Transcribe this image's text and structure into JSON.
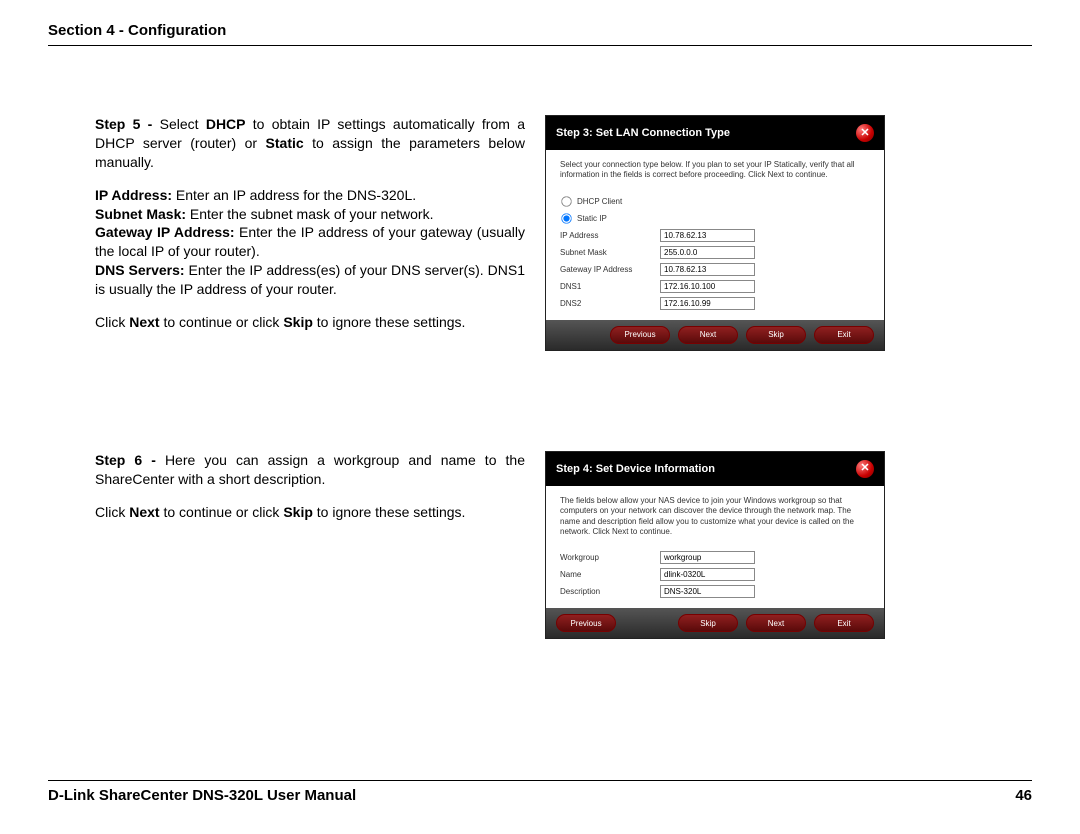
{
  "header": {
    "section": "Section 4 - Configuration"
  },
  "footer": {
    "manual": "D-Link ShareCenter DNS-320L User Manual",
    "page": "46"
  },
  "step5": {
    "para1_pre": "Step 5 - ",
    "para1_a": "Select ",
    "para1_dhcp": "DHCP",
    "para1_b": " to obtain IP settings automatically from a DHCP server (router) or ",
    "para1_static": "Static",
    "para1_c": " to assign the parameters below manually.",
    "ip_b": "IP Address:",
    "ip_t": " Enter an IP address for the DNS-320L.",
    "sm_b": "Subnet Mask:",
    "sm_t": " Enter the subnet mask of your network.",
    "gw_b": "Gateway IP Address:",
    "gw_t": " Enter the IP address of your gateway (usually the local IP of your router).",
    "dns_b": "DNS Servers:",
    "dns_t": " Enter the IP address(es) of your DNS server(s). DNS1 is usually the IP address of your router.",
    "click_a": "Click ",
    "click_next": "Next",
    "click_b": " to continue or click ",
    "click_skip": "Skip",
    "click_c": " to ignore these settings."
  },
  "step6": {
    "para1_pre": "Step 6 - ",
    "para1_t": "Here you can assign a workgroup and name to the ShareCenter with a short description.",
    "click_a": "Click ",
    "click_next": "Next",
    "click_b": " to continue or click ",
    "click_skip": "Skip",
    "click_c": " to ignore these settings."
  },
  "dialog1": {
    "title": "Step 3: Set LAN Connection Type",
    "help": "Select your connection type below. If you plan to set your IP Statically, verify that all information in the fields is correct before proceeding. Click Next to continue.",
    "radio_dhcp": "DHCP Client",
    "radio_static": "Static IP",
    "f_ip": "IP Address",
    "v_ip": "10.78.62.13",
    "f_sm": "Subnet Mask",
    "v_sm": "255.0.0.0",
    "f_gw": "Gateway IP Address",
    "v_gw": "10.78.62.13",
    "f_d1": "DNS1",
    "v_d1": "172.16.10.100",
    "f_d2": "DNS2",
    "v_d2": "172.16.10.99",
    "btn_prev": "Previous",
    "btn_next": "Next",
    "btn_skip": "Skip",
    "btn_exit": "Exit"
  },
  "dialog2": {
    "title": "Step 4: Set Device Information",
    "help": "The fields below allow your NAS device to join your Windows workgroup so that computers on your network can discover the device through the network map. The name and description field allow you to customize what your device is called on the network. Click Next to continue.",
    "f_wg": "Workgroup",
    "v_wg": "workgroup",
    "f_nm": "Name",
    "v_nm": "dlink-0320L",
    "f_ds": "Description",
    "v_ds": "DNS-320L",
    "btn_prev": "Previous",
    "btn_skip": "Skip",
    "btn_next": "Next",
    "btn_exit": "Exit"
  }
}
